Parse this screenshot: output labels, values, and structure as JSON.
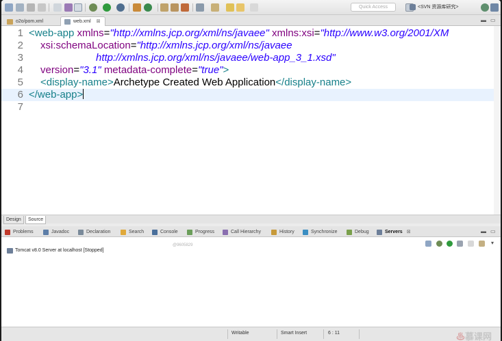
{
  "toolbar": {
    "quick_access_placeholder": "Quick Access",
    "perspective_label": "<SVN 资源库研究>"
  },
  "editor_tabs": [
    {
      "label": "o2o/pom.xml",
      "active": false
    },
    {
      "label": "web.xml",
      "active": true,
      "close": "⊠"
    }
  ],
  "editor": {
    "line_numbers": [
      "1",
      "2",
      "3",
      "4",
      "5",
      "6",
      "7"
    ],
    "line1": {
      "open": "<web-app",
      "attr1": "xmlns",
      "eq1": "=",
      "val1": "\"http://xmlns.jcp.org/xml/ns/javaee\"",
      "attr2": "xmlns:xsi",
      "eq2": "=",
      "val2": "\"http://www.w3.org/2001/XM"
    },
    "line2": {
      "attr": "xsi:schemaLocation",
      "eq": "=",
      "val": "\"http://xmlns.jcp.org/xml/ns/javaee"
    },
    "line3": {
      "val": "http://xmlns.jcp.org/xml/ns/javaee/web-app_3_1.xsd\""
    },
    "line4": {
      "attr1": "version",
      "eq1": "=",
      "val1": "\"3.1\"",
      "attr2": "metadata-complete",
      "eq2": "=",
      "val2": "\"true\"",
      "close": ">"
    },
    "line5": {
      "open": "<display-name>",
      "text": "Archetype Created Web Application",
      "close": "</display-name>"
    },
    "line6": {
      "tag": "</web-app>"
    }
  },
  "design_source_tabs": {
    "design": "Design",
    "source": "Source"
  },
  "views": {
    "tabs": [
      {
        "label": "Problems",
        "color": "#c0392b"
      },
      {
        "label": "Javadoc",
        "color": "#5d7ea8"
      },
      {
        "label": "Declaration",
        "color": "#7a8a9a"
      },
      {
        "label": "Search",
        "color": "#e0a93a"
      },
      {
        "label": "Console",
        "color": "#4a6f9b"
      },
      {
        "label": "Progress",
        "color": "#6b9e5a"
      },
      {
        "label": "Call Hierarchy",
        "color": "#8a6fb0"
      },
      {
        "label": "History",
        "color": "#c79a3a"
      },
      {
        "label": "Synchronize",
        "color": "#3b8ec2"
      },
      {
        "label": "Debug",
        "color": "#7aa04c"
      },
      {
        "label": "Servers",
        "color": "#6d7f99",
        "active": true
      }
    ],
    "close_icon": "⊠",
    "watermark": "@9605829",
    "server_entry": "Tomcat v8.0 Server at localhost  [Stopped]"
  },
  "status": {
    "writable": "Writable",
    "insert_mode": "Smart Insert",
    "position": "6 : 11"
  },
  "logo": {
    "flame": "♨",
    "text": "慕课网"
  }
}
